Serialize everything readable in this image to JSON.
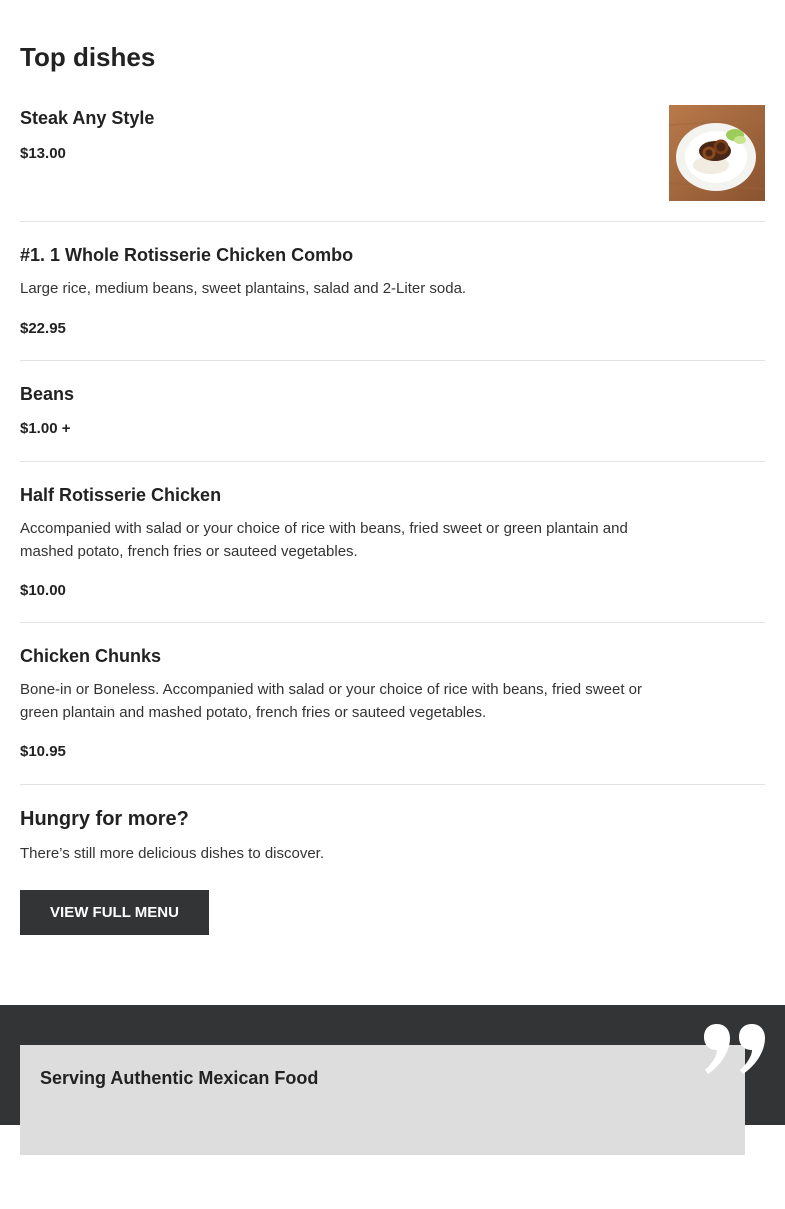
{
  "section": {
    "title": "Top dishes"
  },
  "dishes": [
    {
      "name": "Steak Any Style",
      "description": "",
      "price": "$13.00",
      "has_image": true
    },
    {
      "name": "#1. 1 Whole Rotisserie Chicken Combo",
      "description": "Large rice, medium beans, sweet plantains, salad and 2-Liter soda.",
      "price": "$22.95"
    },
    {
      "name": "Beans",
      "description": "",
      "price": "$1.00 +"
    },
    {
      "name": "Half Rotisserie Chicken",
      "description": "Accompanied with salad or your choice of rice with beans, fried sweet or green plantain and mashed potato, french fries or sauteed vegetables.",
      "price": "$10.00"
    },
    {
      "name": "Chicken Chunks",
      "description": "Bone-in or Boneless. Accompanied with salad or your choice of rice with beans, fried sweet or green plantain and mashed potato, french fries or sauteed vegetables.",
      "price": "$10.95"
    }
  ],
  "more": {
    "title": "Hungry for more?",
    "text": "There’s still more delicious dishes to discover.",
    "button_label": "VIEW FULL MENU"
  },
  "testimonial": {
    "title": "Serving Authentic Mexican Food"
  },
  "colors": {
    "dark": "#333436",
    "card": "#dddddd",
    "divider": "#e2e2e2"
  },
  "icons": {
    "quote": "quote-icon"
  }
}
